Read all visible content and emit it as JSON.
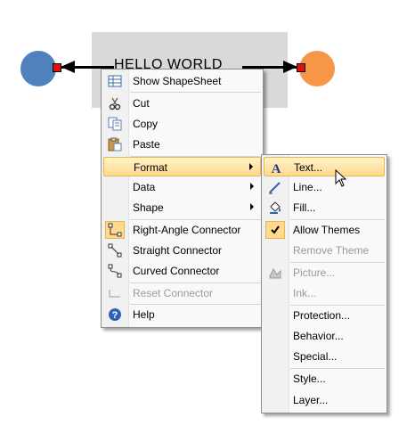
{
  "canvas": {
    "shape_text": "HELLO WORLD",
    "left_circle_color": "#4f81bd",
    "right_circle_color": "#f79646"
  },
  "context_menu": {
    "items": [
      {
        "label": "Show ShapeSheet",
        "icon": "shapesheet-icon"
      },
      {
        "label": "Cut",
        "icon": "scissors-icon"
      },
      {
        "label": "Copy",
        "icon": "copy-icon"
      },
      {
        "label": "Paste",
        "icon": "paste-icon"
      },
      {
        "label": "Format",
        "submenu": true
      },
      {
        "label": "Data",
        "submenu": true
      },
      {
        "label": "Shape",
        "submenu": true
      },
      {
        "label": "Right-Angle Connector",
        "icon": "right-angle-connector-icon",
        "checked": true
      },
      {
        "label": "Straight Connector",
        "icon": "straight-connector-icon"
      },
      {
        "label": "Curved Connector",
        "icon": "curved-connector-icon"
      },
      {
        "label": "Reset Connector",
        "icon": "reset-connector-icon",
        "disabled": true
      },
      {
        "label": "Help",
        "icon": "help-icon"
      }
    ]
  },
  "format_submenu": {
    "items": [
      {
        "label": "Text...",
        "icon": "text-format-icon",
        "highlighted": true
      },
      {
        "label": "Line...",
        "icon": "line-format-icon"
      },
      {
        "label": "Fill...",
        "icon": "fill-bucket-icon"
      },
      {
        "label": "Allow Themes",
        "checked": true
      },
      {
        "label": "Remove Theme",
        "disabled": true
      },
      {
        "label": "Picture...",
        "icon": "picture-icon",
        "disabled": true
      },
      {
        "label": "Ink...",
        "disabled": true
      },
      {
        "label": "Protection..."
      },
      {
        "label": "Behavior..."
      },
      {
        "label": "Special..."
      },
      {
        "label": "Style..."
      },
      {
        "label": "Layer..."
      }
    ]
  }
}
